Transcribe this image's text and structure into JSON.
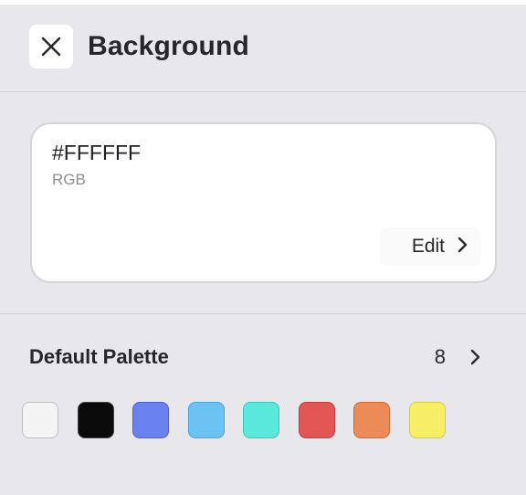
{
  "header": {
    "title": "Background"
  },
  "color": {
    "hex": "#FFFFFF",
    "mode": "RGB",
    "edit_label": "Edit"
  },
  "palette": {
    "title": "Default Palette",
    "count": "8",
    "swatches": [
      {
        "fill": "#f3f3f3",
        "border": "#bfbfbf"
      },
      {
        "fill": "#0b0b0b",
        "border": "#444444"
      },
      {
        "fill": "#6a82f0",
        "border": "#4a5fc9"
      },
      {
        "fill": "#6cc3f3",
        "border": "#4aa3d6"
      },
      {
        "fill": "#5ae8dc",
        "border": "#3cc4b8"
      },
      {
        "fill": "#e35656",
        "border": "#c23c3c"
      },
      {
        "fill": "#ec8a58",
        "border": "#cc6a3a"
      },
      {
        "fill": "#f6ee66",
        "border": "#d4cc44"
      }
    ]
  },
  "icons": {
    "close": "close-icon",
    "edit_chevron": "chevron-right-icon",
    "palette_chevron": "chevron-right-icon"
  }
}
